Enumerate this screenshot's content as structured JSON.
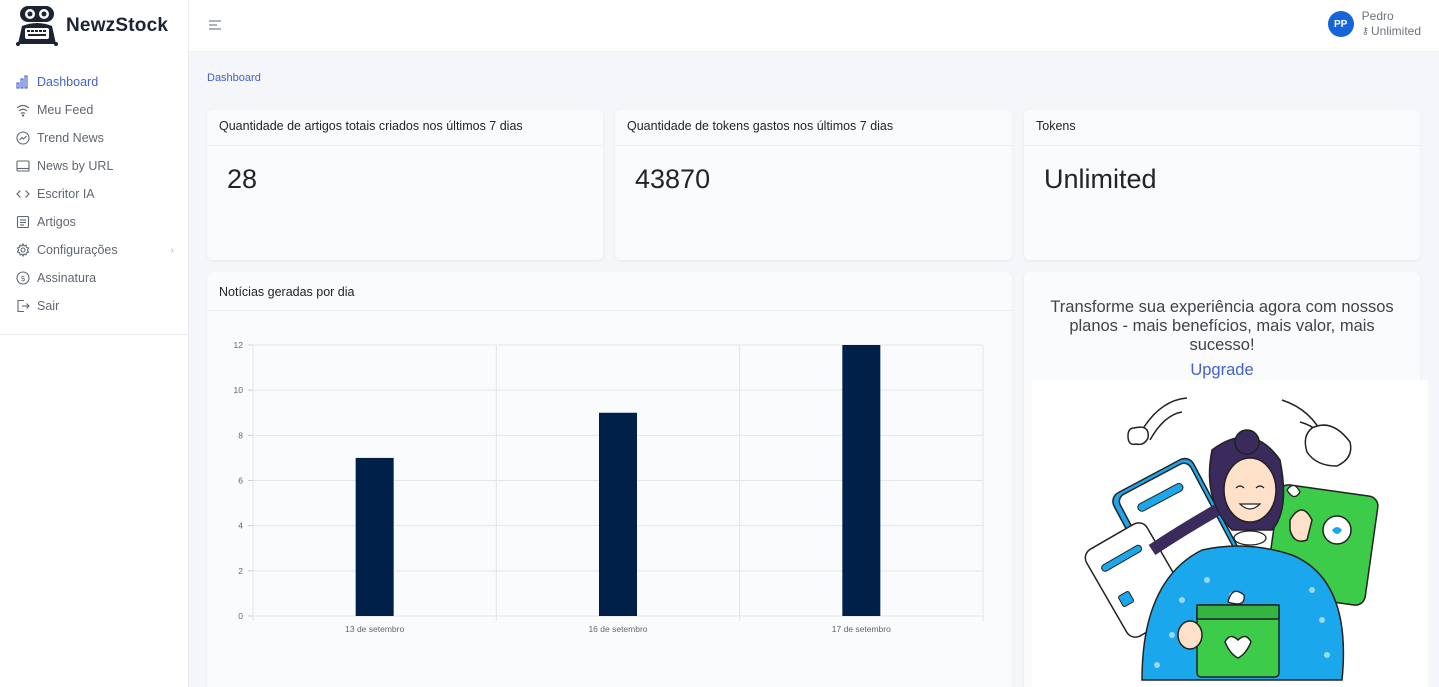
{
  "app": {
    "name": "NewzStock"
  },
  "sidebar": {
    "items": [
      {
        "label": "Dashboard",
        "icon": "bar-chart-icon",
        "active": true
      },
      {
        "label": "Meu Feed",
        "icon": "wifi-icon"
      },
      {
        "label": "Trend News",
        "icon": "trend-icon"
      },
      {
        "label": "News by URL",
        "icon": "monitor-icon"
      },
      {
        "label": "Escritor IA",
        "icon": "code-icon"
      },
      {
        "label": "Artigos",
        "icon": "document-icon"
      },
      {
        "label": "Configurações",
        "icon": "gear-icon",
        "has_submenu": true
      },
      {
        "label": "Assinatura",
        "icon": "dollar-icon"
      },
      {
        "label": "Sair",
        "icon": "logout-icon"
      }
    ]
  },
  "header": {
    "user": {
      "initials": "PP",
      "name": "Pedro",
      "plan": "Unlimited"
    }
  },
  "breadcrumb": "Dashboard",
  "stats": [
    {
      "title": "Quantidade de artigos totais criados nos últimos 7 dias",
      "value": "28"
    },
    {
      "title": "Quantidade de tokens gastos nos últimos 7 dias",
      "value": "43870"
    },
    {
      "title": "Tokens",
      "value": "Unlimited"
    }
  ],
  "chart_card": {
    "title": "Notícias geradas por dia"
  },
  "chart_data": {
    "type": "bar",
    "title": "Notícias geradas por dia",
    "categories": [
      "13 de setembro",
      "16 de setembro",
      "17 de setembro"
    ],
    "values": [
      7,
      9,
      12
    ],
    "ylim": [
      0,
      12
    ],
    "yticks": [
      0,
      2,
      4,
      6,
      8,
      10,
      12
    ],
    "grid": true,
    "bar_color": "#00204a"
  },
  "promo": {
    "text": "Transforme sua experiência agora com nossos planos - mais benefícios, mais valor, mais sucesso!",
    "link": "Upgrade"
  },
  "colors": {
    "accent": "#4361c9",
    "bar": "#00204a",
    "avatar": "#1565d8"
  }
}
